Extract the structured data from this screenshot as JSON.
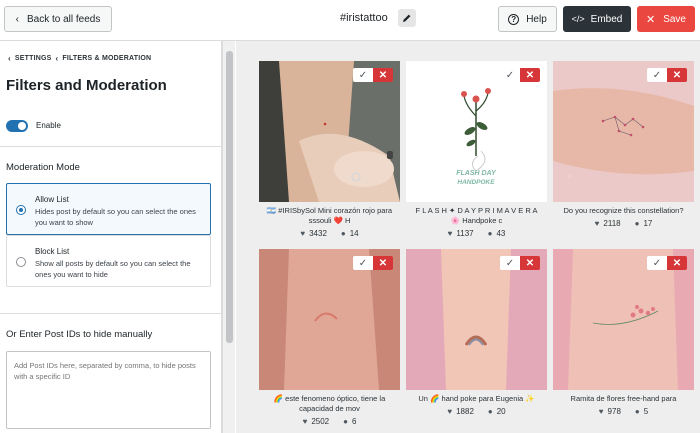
{
  "header": {
    "back_label": "Back to all feeds",
    "feed_name": "#iristattoo",
    "help_label": "Help",
    "embed_label": "Embed",
    "save_label": "Save"
  },
  "sidebar": {
    "breadcrumb": [
      "SETTINGS",
      "FILTERS & MODERATION"
    ],
    "title": "Filters and Moderation",
    "toggle_label": "Enable",
    "moderation_heading": "Moderation Mode",
    "options": [
      {
        "title": "Allow List",
        "description": "Hides post by default so you can select the ones you want to show",
        "selected": true
      },
      {
        "title": "Block List",
        "description": "Show all posts by default so you can select the ones you want to hide",
        "selected": false
      }
    ],
    "ids_heading": "Or Enter Post IDs to hide manually",
    "ids_placeholder": "Add Post IDs here, separated by comma, to hide posts with a specific ID"
  },
  "posts": [
    {
      "caption_l1": "🇦🇷 #IRISbySol Mini corazón rojo para",
      "caption_l2": "sssouli ❤️ H",
      "likes": "3432",
      "comments": "14"
    },
    {
      "caption_l1": "F L A S H ✦ D A Y P R I M A V E R A",
      "caption_l2": "🌸 Handpoke c",
      "likes": "1137",
      "comments": "43"
    },
    {
      "caption_l1": "Do you recognize this constellation?",
      "caption_l2": "",
      "likes": "2118",
      "comments": "17"
    },
    {
      "caption_l1": "🌈 este fenomeno óptico, tiene la",
      "caption_l2": "capacidad de mov",
      "likes": "2502",
      "comments": "6"
    },
    {
      "caption_l1": "Un 🌈 hand poke para Eugenia ✨",
      "caption_l2": "",
      "likes": "1882",
      "comments": "20"
    },
    {
      "caption_l1": "Ramita de flores free-hand para",
      "caption_l2": "",
      "likes": "978",
      "comments": "5"
    }
  ],
  "flash_text": [
    "FLASH DAY",
    "HANDPOKE"
  ],
  "colors": {
    "accent": "#2271b1",
    "save": "#e9473f",
    "embed": "#2c3338",
    "reject": "#d63638"
  }
}
